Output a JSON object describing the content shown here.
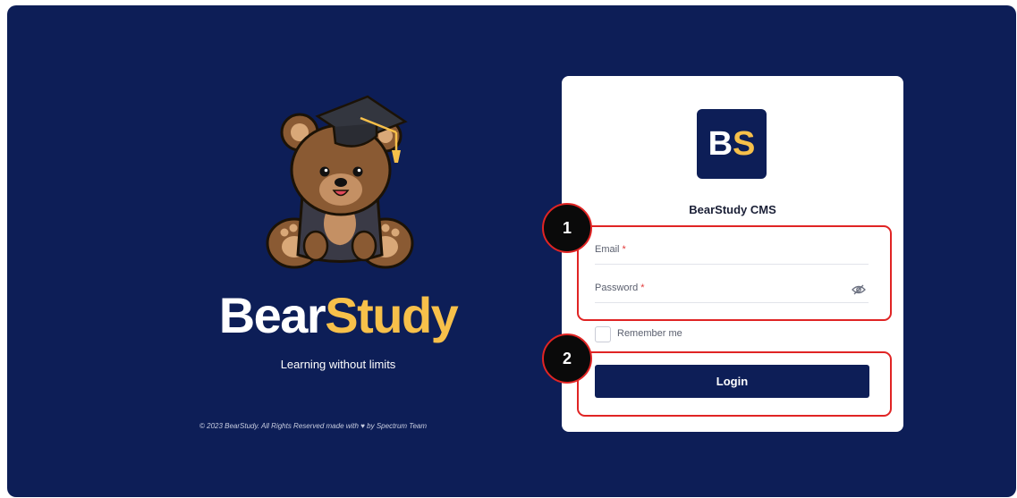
{
  "brand": {
    "name_part1": "Bear",
    "name_part2": "Study",
    "tagline": "Learning without limits"
  },
  "footer": {
    "copyright": "© 2023 BearStudy. All Rights Reserved made with ♥ by Spectrum Team"
  },
  "login_card": {
    "logo_part1": "B",
    "logo_part2": "S",
    "title": "BearStudy CMS",
    "email": {
      "label": "Email",
      "required_mark": "*",
      "value": ""
    },
    "password": {
      "label": "Password",
      "required_mark": "*",
      "value": ""
    },
    "remember": {
      "label": "Remember me",
      "checked": false
    },
    "login_label": "Login"
  },
  "annotations": {
    "step1": "1",
    "step2": "2"
  },
  "colors": {
    "background": "#0d1e57",
    "accent": "#f7c04a",
    "card": "#ffffff",
    "annotation": "#e02424",
    "required": "#e23b3b"
  },
  "icons": {
    "password_toggle": "eye-slash-icon",
    "mascot": "graduation-bear-icon"
  }
}
